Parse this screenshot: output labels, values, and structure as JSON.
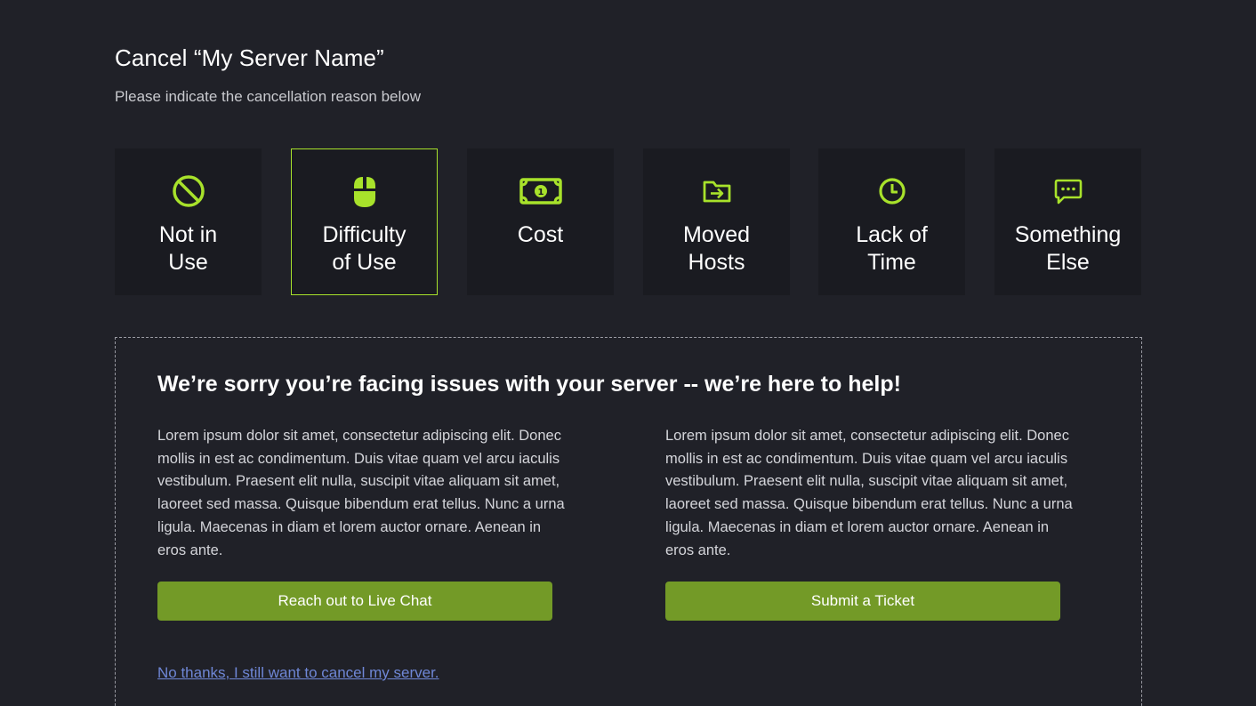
{
  "header": {
    "title": "Cancel “My Server Name”",
    "subtitle": "Please indicate the cancellation reason below"
  },
  "reasons": [
    {
      "label": "Not in\nUse",
      "icon": "prohibited-icon",
      "selected": false
    },
    {
      "label": "Difficulty\nof Use",
      "icon": "mouse-icon",
      "selected": true
    },
    {
      "label": "Cost",
      "icon": "banknote-icon",
      "selected": false
    },
    {
      "label": "Moved\nHosts",
      "icon": "folder-move-icon",
      "selected": false
    },
    {
      "label": "Lack of\nTime",
      "icon": "clock-icon",
      "selected": false
    },
    {
      "label": "Something\nElse",
      "icon": "chat-bubble-icon",
      "selected": false
    }
  ],
  "help": {
    "heading": "We’re sorry you’re facing issues with your server -- we’re here to help!",
    "left_text": "Lorem ipsum dolor sit amet, consectetur adipiscing elit. Donec mollis in est ac condimentum. Duis vitae quam vel arcu iaculis vestibulum. Praesent elit nulla, suscipit vitae aliquam sit amet, laoreet sed massa. Quisque bibendum erat tellus. Nunc a urna ligula. Maecenas in diam et lorem auctor ornare. Aenean in eros ante.",
    "right_text": "Lorem ipsum dolor sit amet, consectetur adipiscing elit. Donec mollis in est ac condimentum. Duis vitae quam vel arcu iaculis vestibulum. Praesent elit nulla, suscipit vitae aliquam sit amet, laoreet sed massa. Quisque bibendum erat tellus. Nunc a urna ligula. Maecenas in diam et lorem auctor ornare. Aenean in eros ante.",
    "live_chat_label": "Reach out to Live Chat",
    "ticket_label": "Submit a Ticket",
    "cancel_link": "No thanks, I still want to cancel my server."
  },
  "colors": {
    "background": "#202128",
    "card": "#1a1b21",
    "accent": "#a8e22b",
    "button": "#739a27",
    "link": "#6f87d6"
  }
}
